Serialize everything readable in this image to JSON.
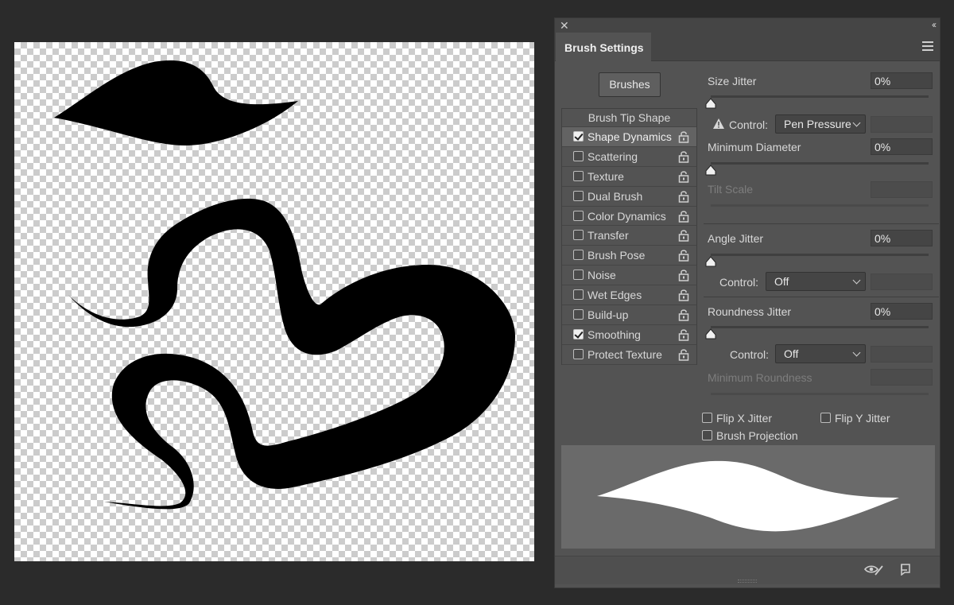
{
  "panel": {
    "title": "Brush Settings",
    "close_glyph": "✕",
    "collapse_glyph": "‹‹",
    "brushes_button": "Brushes"
  },
  "sidebar": {
    "header": "Brush Tip Shape",
    "items": [
      {
        "label": "Shape Dynamics",
        "checked": true,
        "selected": true
      },
      {
        "label": "Scattering",
        "checked": false
      },
      {
        "label": "Texture",
        "checked": false
      },
      {
        "label": "Dual Brush",
        "checked": false
      },
      {
        "label": "Color Dynamics",
        "checked": false
      },
      {
        "label": "Transfer",
        "checked": false
      },
      {
        "label": "Brush Pose",
        "checked": false
      },
      {
        "label": "Noise",
        "checked": false
      },
      {
        "label": "Wet Edges",
        "checked": false
      },
      {
        "label": "Build-up",
        "checked": false
      },
      {
        "label": "Smoothing",
        "checked": true
      },
      {
        "label": "Protect Texture",
        "checked": false
      }
    ]
  },
  "settings": {
    "size_jitter": {
      "label": "Size Jitter",
      "value": "0%",
      "level": 0
    },
    "size_control": {
      "label": "Control:",
      "value": "Pen Pressure"
    },
    "min_diameter": {
      "label": "Minimum Diameter",
      "value": "0%",
      "level": 0
    },
    "tilt_scale": {
      "label": "Tilt Scale"
    },
    "angle_jitter": {
      "label": "Angle Jitter",
      "value": "0%",
      "level": 0
    },
    "angle_control": {
      "label": "Control:",
      "value": "Off"
    },
    "roundness_jitter": {
      "label": "Roundness Jitter",
      "value": "0%",
      "level": 0
    },
    "roundness_control": {
      "label": "Control:",
      "value": "Off"
    },
    "min_roundness": {
      "label": "Minimum Roundness"
    },
    "flip_x": {
      "label": "Flip X Jitter",
      "checked": false
    },
    "flip_y": {
      "label": "Flip Y Jitter",
      "checked": false
    },
    "brush_projection": {
      "label": "Brush Projection",
      "checked": false
    }
  },
  "icons": {
    "close": "close-icon",
    "collapse": "collapse-icon",
    "menu": "panel-menu-icon",
    "lock": "lock-icon",
    "warning": "warning-icon",
    "toggle_preview": "toggle-preview-icon",
    "new_preset": "new-preset-icon"
  },
  "colors": {
    "app_bg": "#2b2b2b",
    "panel_bg": "#535353",
    "field_bg": "#454545",
    "stroke": "#000000",
    "preview_bg": "#6a6a6a",
    "preview_stroke": "#ffffff"
  }
}
